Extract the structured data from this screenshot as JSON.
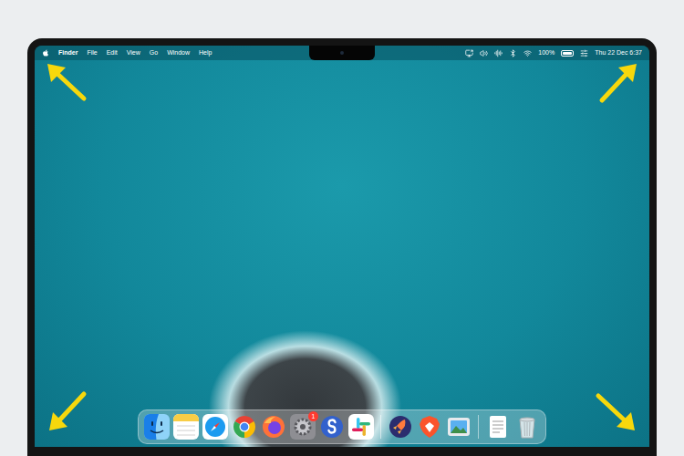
{
  "menu_bar": {
    "app": "Finder",
    "menus": [
      "File",
      "Edit",
      "View",
      "Go",
      "Window",
      "Help"
    ],
    "battery": {
      "reading": "100%",
      "level": 1
    },
    "clock": "Thu 22 Dec 6:37"
  },
  "dock": {
    "items": [
      {
        "kind": "finder"
      },
      {
        "kind": "notes"
      },
      {
        "kind": "safari"
      },
      {
        "kind": "chrome"
      },
      {
        "kind": "firefox"
      },
      {
        "kind": "settings",
        "badge": "1"
      },
      {
        "kind": "simplenote"
      },
      {
        "kind": "slack"
      },
      {
        "kind": "separator"
      },
      {
        "kind": "rocket"
      },
      {
        "kind": "brave"
      },
      {
        "kind": "preview"
      },
      {
        "kind": "separator"
      },
      {
        "kind": "document"
      },
      {
        "kind": "trash"
      }
    ]
  },
  "hot_corner_arrows": [
    "top-left",
    "top-right",
    "bottom-left",
    "bottom-right"
  ]
}
